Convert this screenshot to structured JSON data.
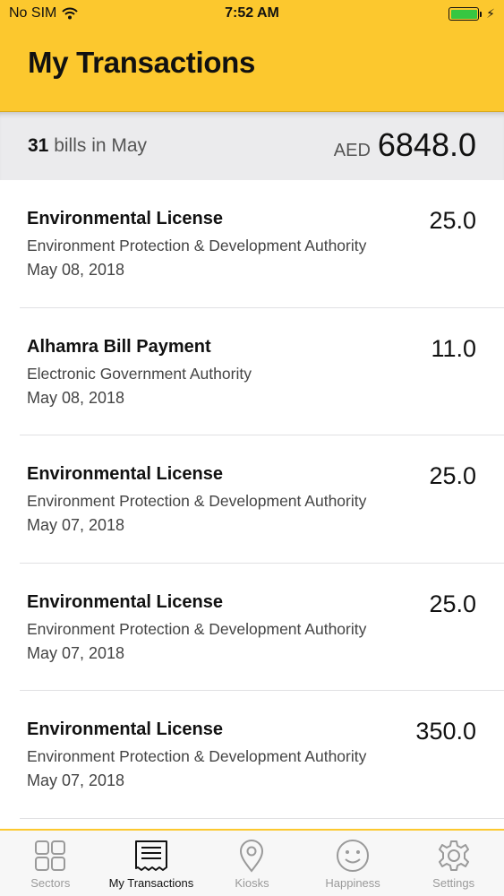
{
  "status_bar": {
    "carrier": "No SIM",
    "time": "7:52 AM",
    "battery_color": "#37c741",
    "charging_icon": "⚡"
  },
  "header": {
    "title": "My Transactions",
    "background": "#FCC82E"
  },
  "summary": {
    "count": "31",
    "count_suffix": " bills in May",
    "currency": "AED",
    "total": "6848.0"
  },
  "transactions": [
    {
      "title": "Environmental License",
      "authority": "Environment Protection & Development Authority",
      "date": "May 08, 2018",
      "amount": "25.0"
    },
    {
      "title": "Alhamra Bill Payment",
      "authority": "Electronic Government Authority",
      "date": "May 08, 2018",
      "amount": "11.0"
    },
    {
      "title": "Environmental License",
      "authority": "Environment Protection & Development Authority",
      "date": "May 07, 2018",
      "amount": "25.0"
    },
    {
      "title": "Environmental License",
      "authority": "Environment Protection & Development Authority",
      "date": "May 07, 2018",
      "amount": "25.0"
    },
    {
      "title": "Environmental License",
      "authority": "Environment Protection & Development Authority",
      "date": "May 07, 2018",
      "amount": "350.0"
    }
  ],
  "tabs": [
    {
      "label": "Sectors",
      "icon": "grid-icon",
      "active": false
    },
    {
      "label": "My Transactions",
      "icon": "receipt-icon",
      "active": true
    },
    {
      "label": "Kiosks",
      "icon": "location-pin-icon",
      "active": false
    },
    {
      "label": "Happiness",
      "icon": "smiley-icon",
      "active": false
    },
    {
      "label": "Settings",
      "icon": "gear-icon",
      "active": false
    }
  ]
}
